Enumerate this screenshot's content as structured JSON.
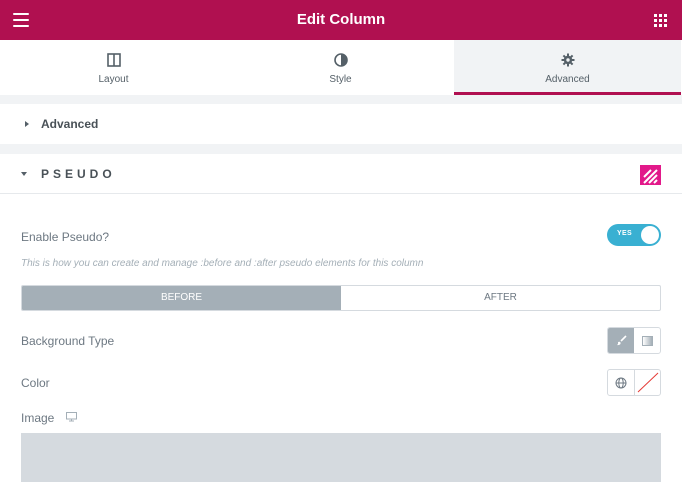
{
  "header": {
    "title": "Edit Column",
    "menu_icon": "hamburger-icon",
    "apps_icon": "grid-icon",
    "color": "#b01050"
  },
  "tabs": [
    {
      "label": "Layout",
      "icon": "columns-icon",
      "active": false
    },
    {
      "label": "Style",
      "icon": "half-circle-icon",
      "active": false
    },
    {
      "label": "Advanced",
      "icon": "gear-icon",
      "active": true
    }
  ],
  "sections": {
    "advanced": {
      "title": "Advanced",
      "expanded": false
    },
    "pseudo": {
      "title": "PSEUDO",
      "expanded": true,
      "brand_icon": "plugin-logo-icon",
      "brand_color": "#e2198a"
    }
  },
  "controls": {
    "enable_pseudo": {
      "label": "Enable Pseudo?",
      "value_text": "YES",
      "on": true
    },
    "hint": "This is how you can create and manage :before and :after pseudo elements for this column",
    "pseudo_switch": {
      "options": [
        "BEFORE",
        "AFTER"
      ],
      "selected": "BEFORE"
    },
    "background_type": {
      "label": "Background Type",
      "options": [
        "classic-brush-icon",
        "gradient-icon"
      ],
      "selected": "classic-brush-icon"
    },
    "color": {
      "label": "Color",
      "globe_icon": "globe-icon",
      "clear_icon": "no-color-icon"
    },
    "image": {
      "label": "Image",
      "responsive_icon": "desktop-icon"
    }
  }
}
